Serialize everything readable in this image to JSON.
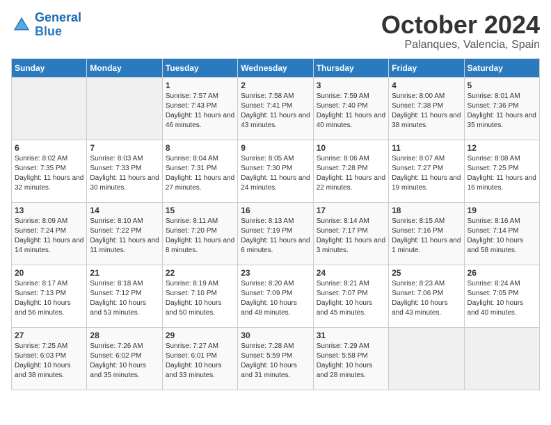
{
  "header": {
    "logo_line1": "General",
    "logo_line2": "Blue",
    "month": "October 2024",
    "location": "Palanques, Valencia, Spain"
  },
  "days_of_week": [
    "Sunday",
    "Monday",
    "Tuesday",
    "Wednesday",
    "Thursday",
    "Friday",
    "Saturday"
  ],
  "weeks": [
    [
      {
        "day": "",
        "content": ""
      },
      {
        "day": "",
        "content": ""
      },
      {
        "day": "1",
        "content": "Sunrise: 7:57 AM\nSunset: 7:43 PM\nDaylight: 11 hours and 46 minutes."
      },
      {
        "day": "2",
        "content": "Sunrise: 7:58 AM\nSunset: 7:41 PM\nDaylight: 11 hours and 43 minutes."
      },
      {
        "day": "3",
        "content": "Sunrise: 7:59 AM\nSunset: 7:40 PM\nDaylight: 11 hours and 40 minutes."
      },
      {
        "day": "4",
        "content": "Sunrise: 8:00 AM\nSunset: 7:38 PM\nDaylight: 11 hours and 38 minutes."
      },
      {
        "day": "5",
        "content": "Sunrise: 8:01 AM\nSunset: 7:36 PM\nDaylight: 11 hours and 35 minutes."
      }
    ],
    [
      {
        "day": "6",
        "content": "Sunrise: 8:02 AM\nSunset: 7:35 PM\nDaylight: 11 hours and 32 minutes."
      },
      {
        "day": "7",
        "content": "Sunrise: 8:03 AM\nSunset: 7:33 PM\nDaylight: 11 hours and 30 minutes."
      },
      {
        "day": "8",
        "content": "Sunrise: 8:04 AM\nSunset: 7:31 PM\nDaylight: 11 hours and 27 minutes."
      },
      {
        "day": "9",
        "content": "Sunrise: 8:05 AM\nSunset: 7:30 PM\nDaylight: 11 hours and 24 minutes."
      },
      {
        "day": "10",
        "content": "Sunrise: 8:06 AM\nSunset: 7:28 PM\nDaylight: 11 hours and 22 minutes."
      },
      {
        "day": "11",
        "content": "Sunrise: 8:07 AM\nSunset: 7:27 PM\nDaylight: 11 hours and 19 minutes."
      },
      {
        "day": "12",
        "content": "Sunrise: 8:08 AM\nSunset: 7:25 PM\nDaylight: 11 hours and 16 minutes."
      }
    ],
    [
      {
        "day": "13",
        "content": "Sunrise: 8:09 AM\nSunset: 7:24 PM\nDaylight: 11 hours and 14 minutes."
      },
      {
        "day": "14",
        "content": "Sunrise: 8:10 AM\nSunset: 7:22 PM\nDaylight: 11 hours and 11 minutes."
      },
      {
        "day": "15",
        "content": "Sunrise: 8:11 AM\nSunset: 7:20 PM\nDaylight: 11 hours and 8 minutes."
      },
      {
        "day": "16",
        "content": "Sunrise: 8:13 AM\nSunset: 7:19 PM\nDaylight: 11 hours and 6 minutes."
      },
      {
        "day": "17",
        "content": "Sunrise: 8:14 AM\nSunset: 7:17 PM\nDaylight: 11 hours and 3 minutes."
      },
      {
        "day": "18",
        "content": "Sunrise: 8:15 AM\nSunset: 7:16 PM\nDaylight: 11 hours and 1 minute."
      },
      {
        "day": "19",
        "content": "Sunrise: 8:16 AM\nSunset: 7:14 PM\nDaylight: 10 hours and 58 minutes."
      }
    ],
    [
      {
        "day": "20",
        "content": "Sunrise: 8:17 AM\nSunset: 7:13 PM\nDaylight: 10 hours and 56 minutes."
      },
      {
        "day": "21",
        "content": "Sunrise: 8:18 AM\nSunset: 7:12 PM\nDaylight: 10 hours and 53 minutes."
      },
      {
        "day": "22",
        "content": "Sunrise: 8:19 AM\nSunset: 7:10 PM\nDaylight: 10 hours and 50 minutes."
      },
      {
        "day": "23",
        "content": "Sunrise: 8:20 AM\nSunset: 7:09 PM\nDaylight: 10 hours and 48 minutes."
      },
      {
        "day": "24",
        "content": "Sunrise: 8:21 AM\nSunset: 7:07 PM\nDaylight: 10 hours and 45 minutes."
      },
      {
        "day": "25",
        "content": "Sunrise: 8:23 AM\nSunset: 7:06 PM\nDaylight: 10 hours and 43 minutes."
      },
      {
        "day": "26",
        "content": "Sunrise: 8:24 AM\nSunset: 7:05 PM\nDaylight: 10 hours and 40 minutes."
      }
    ],
    [
      {
        "day": "27",
        "content": "Sunrise: 7:25 AM\nSunset: 6:03 PM\nDaylight: 10 hours and 38 minutes."
      },
      {
        "day": "28",
        "content": "Sunrise: 7:26 AM\nSunset: 6:02 PM\nDaylight: 10 hours and 35 minutes."
      },
      {
        "day": "29",
        "content": "Sunrise: 7:27 AM\nSunset: 6:01 PM\nDaylight: 10 hours and 33 minutes."
      },
      {
        "day": "30",
        "content": "Sunrise: 7:28 AM\nSunset: 5:59 PM\nDaylight: 10 hours and 31 minutes."
      },
      {
        "day": "31",
        "content": "Sunrise: 7:29 AM\nSunset: 5:58 PM\nDaylight: 10 hours and 28 minutes."
      },
      {
        "day": "",
        "content": ""
      },
      {
        "day": "",
        "content": ""
      }
    ]
  ]
}
